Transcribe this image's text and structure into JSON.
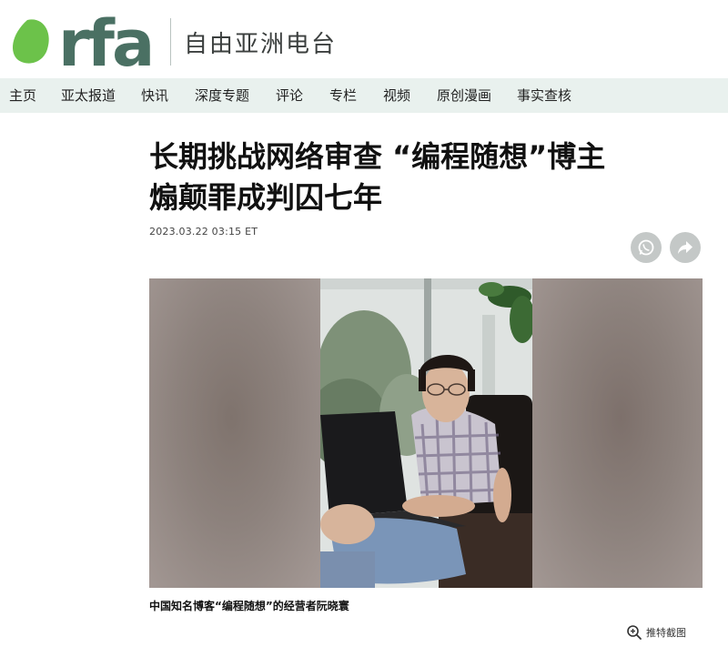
{
  "header": {
    "logo_text": "rfa",
    "station_name": "自由亚洲电台",
    "brand_color": "#4a7063",
    "accent_color": "#6cc24a"
  },
  "nav": {
    "items": [
      "主页",
      "亚太报道",
      "快讯",
      "深度专题",
      "评论",
      "专栏",
      "视频",
      "原创漫画",
      "事实查核"
    ]
  },
  "article": {
    "title_line1": "长期挑战网络审查 “编程随想”博主",
    "title_line2": "煽颠罪成判囚七年",
    "timestamp": "2023.03.22 03:15 ET",
    "caption": "中国知名博客“编程随想”的经营者阮晓寰"
  },
  "share": {
    "icons": [
      "whatsapp-icon",
      "share-arrow-icon"
    ]
  },
  "image_tools": {
    "zoom_label": "推特截图"
  }
}
